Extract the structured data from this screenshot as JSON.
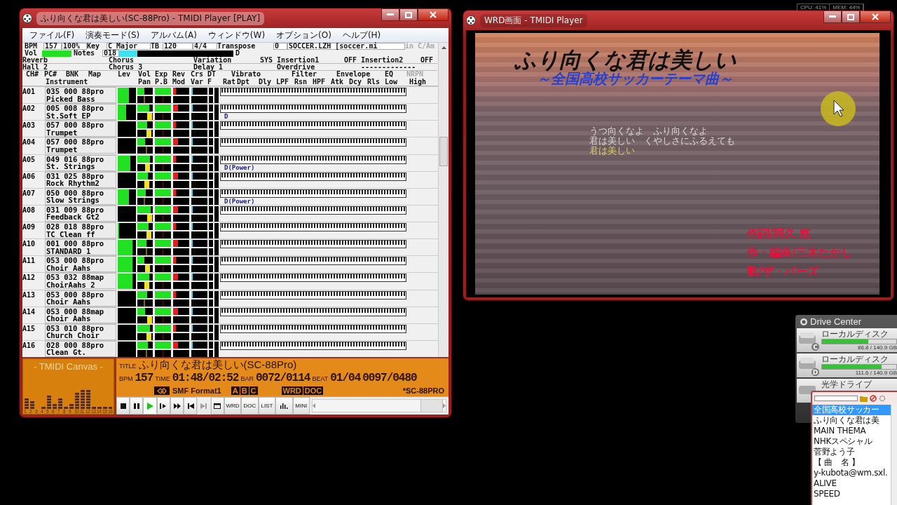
{
  "player": {
    "title": "ふり向くな君は美しい(SC-88Pro) - TMIDI Player [PLAY]",
    "menu": [
      "ファイル(F)",
      "演奏モード(S)",
      "アルバム(A)",
      "ウィンドウ(W)",
      "オプション(O)",
      "ヘルプ(H)"
    ],
    "status": {
      "bpm_label": "BPM",
      "bpm": "157",
      "percent": "100%",
      "key_label": "Key",
      "key": "C Major",
      "tb_label": "TB",
      "tb": "120",
      "meter": "4/4",
      "transpose_label": "Transpose",
      "transpose": "0",
      "file": "SOCCER.LZH [soccer.mi",
      "key_hint": "in C/Am"
    },
    "vol": {
      "label": "Vol",
      "level": 1
    },
    "notes": {
      "label": "Notes",
      "count": "018",
      "level": 0.16,
      "key": "D"
    },
    "effects": [
      {
        "label": "Reverb",
        "value": "Hall 2"
      },
      {
        "label": "Chorus",
        "value": "Chorus 3"
      },
      {
        "label": "Variation",
        "value": "Delay 1",
        "mode": "SYS"
      },
      {
        "label": "Insertion1",
        "value": "Overdrive",
        "state": "OFF"
      },
      {
        "label": "Insertion2",
        "value": "-------------",
        "state": "OFF"
      }
    ],
    "headings": [
      {
        "text": "CH#",
        "disabled": false
      },
      {
        "text": "PC#",
        "disabled": false
      },
      {
        "text": "BNK",
        "disabled": false
      },
      {
        "text": "Map",
        "disabled": false
      },
      {
        "text": "Lev",
        "disabled": false
      },
      {
        "text": "Vol",
        "disabled": false
      },
      {
        "text": "Exp",
        "disabled": false
      },
      {
        "text": "Rev",
        "disabled": false
      },
      {
        "text": "Crs",
        "disabled": false
      },
      {
        "text": "DT",
        "disabled": false
      },
      {
        "text": "Vibrato",
        "disabled": false
      },
      {
        "text": "Filter",
        "disabled": false
      },
      {
        "text": "Envelope",
        "disabled": false
      },
      {
        "text": "EQ",
        "disabled": false
      },
      {
        "text": "NRPN",
        "disabled": true
      }
    ],
    "subheadings": [
      "Instrument",
      "Pan",
      "P.B",
      "Mod",
      "Var",
      "F",
      "Rat",
      "Dpt",
      "Dly",
      "LPF",
      "Rsn",
      "HPF",
      "Atk",
      "Dcy",
      "Rls",
      "Low",
      "High"
    ],
    "channels": [
      {
        "ch": "A01",
        "program": "035 000 88pro",
        "instrument": "Picked Bass",
        "level": 0.62
      },
      {
        "ch": "A02",
        "program": "005 008 88pro",
        "instrument": "St.Soft EP",
        "level": 0.45,
        "note_label": "D"
      },
      {
        "ch": "A03",
        "program": "057 000 88pro",
        "instrument": "Trumpet",
        "level": 0
      },
      {
        "ch": "A04",
        "program": "057 000 88pro",
        "instrument": "Trumpet",
        "level": 0
      },
      {
        "ch": "A05",
        "program": "049 016 88pro",
        "instrument": "St. Strings",
        "level": 0.68,
        "note_label": "D(Power)"
      },
      {
        "ch": "A06",
        "program": "031 025 88pro",
        "instrument": "Rock Rhythm2",
        "level": 0
      },
      {
        "ch": "A07",
        "program": "050 000 88pro",
        "instrument": "Slow Strings",
        "level": 0.6,
        "note_label": "D(Power)"
      },
      {
        "ch": "A08",
        "program": "031 009 88pro",
        "instrument": "Feedback Gt2",
        "level": 0
      },
      {
        "ch": "A09",
        "program": "028 018 88pro",
        "instrument": "TC Clean ff",
        "level": 0.08
      },
      {
        "ch": "A10",
        "program": "001 000 88pro",
        "instrument": "STANDARD 1",
        "level": 0.8
      },
      {
        "ch": "A11",
        "program": "053 000 88pro",
        "instrument": "Choir Aahs",
        "level": 0.8
      },
      {
        "ch": "A12",
        "program": "053 032 88map",
        "instrument": "ChoirAahs 2",
        "level": 0.8
      },
      {
        "ch": "A13",
        "program": "053 000 88pro",
        "instrument": "Choir Aahs",
        "level": 0
      },
      {
        "ch": "A14",
        "program": "053 000 88map",
        "instrument": "Choir Aahs",
        "level": 0
      },
      {
        "ch": "A15",
        "program": "053 010 88pro",
        "instrument": "Church Choir",
        "level": 0
      },
      {
        "ch": "A16",
        "program": "028 000 88pro",
        "instrument": "Clean Gt.",
        "level": 0
      }
    ],
    "canvas": {
      "title": "- TMIDI Canvas -",
      "labels": [
        "1",
        "2",
        "3",
        "4",
        "5",
        "6",
        "7",
        "8",
        "9",
        "10",
        "11",
        "12",
        "13",
        "14",
        "15",
        "16"
      ]
    },
    "info": {
      "title_label": "TITLE",
      "title": "ふり向くな君は美しい(SC-88Pro)",
      "bpm_label": "BPM",
      "bpm": "157",
      "time_label": "TIME",
      "time": "01:48/02:52",
      "bar_label": "BAR",
      "bar": "0072/0114",
      "beat_label": "BEAT",
      "beat": "01/04",
      "tick": "0097/0480",
      "format": "SMF Format1",
      "parts": [
        "A",
        "B",
        "C"
      ],
      "docs": [
        "WRD",
        "DOC"
      ],
      "module": "*SC-88PRO"
    },
    "toolbar": [
      {
        "kind": "stop",
        "active": false,
        "disabled": false
      },
      {
        "kind": "pause",
        "active": false,
        "disabled": false
      },
      {
        "kind": "play",
        "active": true,
        "disabled": false
      },
      {
        "kind": "step",
        "active": false,
        "disabled": false
      },
      {
        "kind": "forward",
        "active": false,
        "disabled": false
      },
      {
        "kind": "previous",
        "active": false,
        "disabled": false
      },
      {
        "kind": "next",
        "active": false,
        "disabled": true
      },
      {
        "kind": "window",
        "active": false,
        "disabled": false
      },
      {
        "kind": "text",
        "label": "WRD",
        "active": false,
        "disabled": false
      },
      {
        "kind": "text",
        "label": "DOC",
        "active": false,
        "disabled": false
      },
      {
        "kind": "text",
        "label": "LIST",
        "active": false,
        "disabled": false
      },
      {
        "kind": "bars",
        "active": false,
        "disabled": false
      },
      {
        "kind": "text",
        "label": "MINI",
        "active": false,
        "disabled": false
      }
    ]
  },
  "wrd": {
    "title": "WRD画面 - TMIDI Player",
    "song_title": "ふり向くな君は美しい",
    "subtitle": "～全国高校サッカーテーマ曲～",
    "lyrics": [
      {
        "text": "うつ向くなよ　ふり向くなよ",
        "sung": false
      },
      {
        "text": "君は美しい　くやしさにふるえても",
        "sung": false
      },
      {
        "text": "君は美しい",
        "sung": true
      }
    ],
    "credits": [
      "作詞/阿久 悠",
      "作・編曲/三木たかし",
      "歌/ザ・バーズ"
    ]
  },
  "sys_monitor": {
    "cpu": "CPU: 41%",
    "mem": "MEM: 44%"
  },
  "drive_center": {
    "title": "Drive Center",
    "drives": [
      {
        "kind": "disk",
        "letter": "C",
        "name": "ローカルディスク",
        "level": 0.62,
        "usage": "86.8 / 140.9 GB"
      },
      {
        "kind": "disk",
        "letter": "D",
        "name": "ローカルディスク",
        "level": 0.8,
        "usage": "111.6 / 140.9 GB"
      },
      {
        "kind": "optical",
        "name": "光学ドライブ"
      }
    ]
  },
  "playlist": {
    "items": [
      {
        "text": "全国高校サッカー",
        "selected": true
      },
      {
        "text": "ふり向くな君は美",
        "selected": false
      },
      {
        "text": "MAIN THEMA",
        "selected": false
      },
      {
        "text": "NHKスペシャル",
        "selected": false
      },
      {
        "text": "菅野よう子",
        "selected": false
      },
      {
        "text": "【 曲　名 】",
        "selected": false
      },
      {
        "text": "y-kubota@wm.sxl.",
        "selected": false
      },
      {
        "text": "ALIVE",
        "selected": false
      },
      {
        "text": "SPEED",
        "selected": false
      }
    ]
  }
}
